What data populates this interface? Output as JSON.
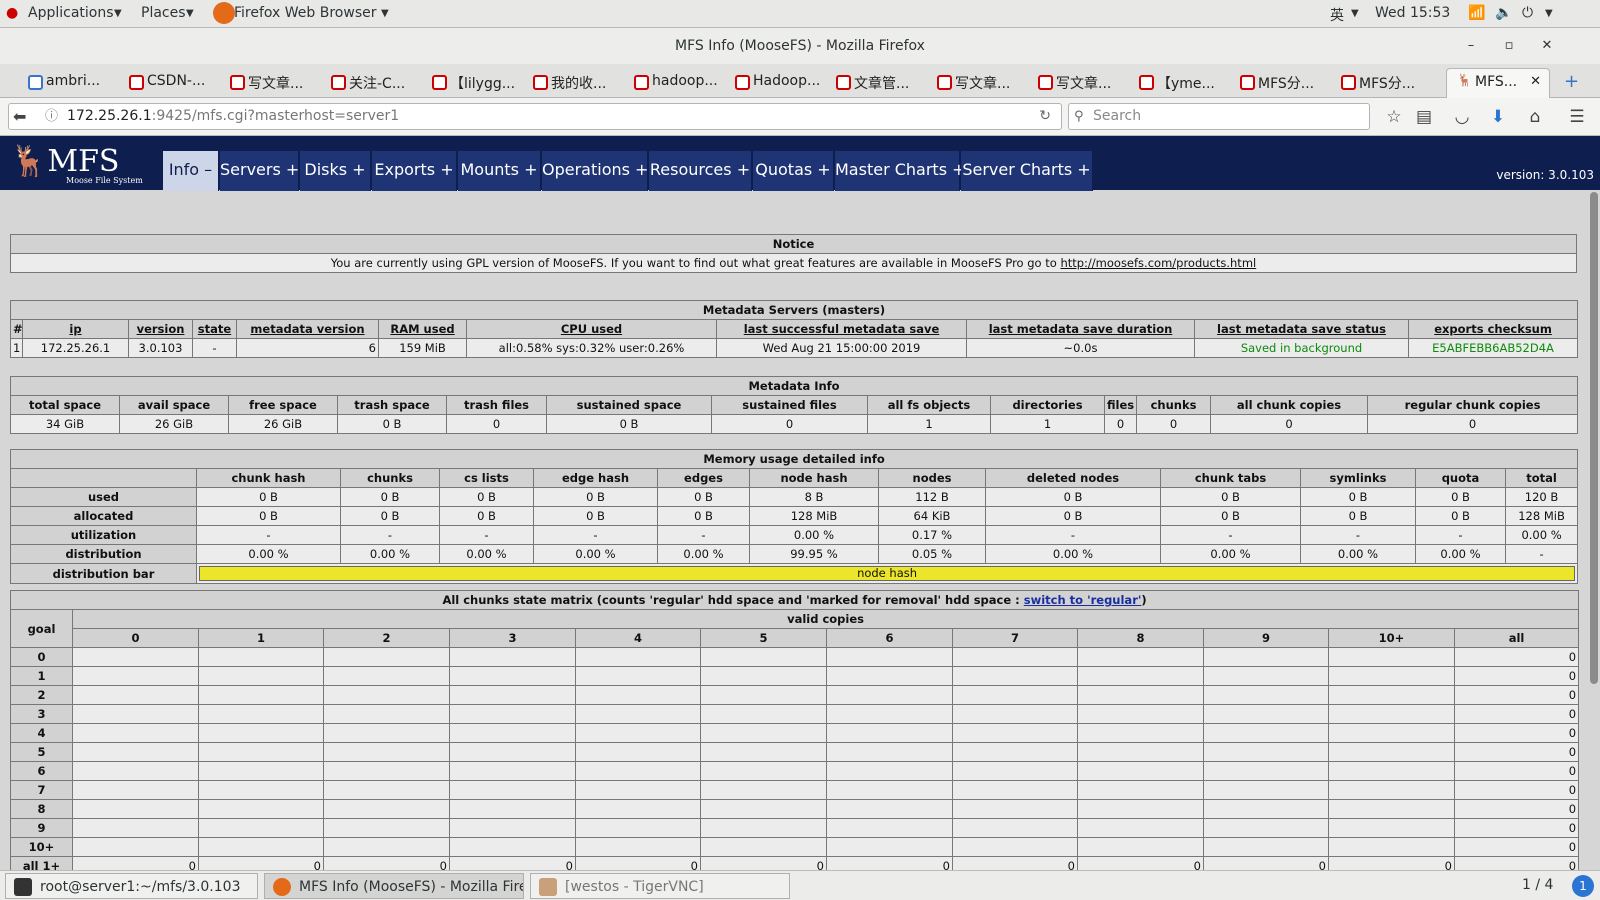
{
  "system_bar": {
    "applications": "Applications",
    "places": "Places",
    "active_app": "Firefox Web Browser",
    "ime": "英",
    "clock": "Wed 15:53"
  },
  "window": {
    "title": "MFS Info (MooseFS) - Mozilla Firefox",
    "minimize": "–",
    "maximize": "▫",
    "close": "✕"
  },
  "tabs": [
    {
      "label": "ambri..."
    },
    {
      "label": "CSDN-..."
    },
    {
      "label": "写文章..."
    },
    {
      "label": "关注-C..."
    },
    {
      "label": "【lilygg..."
    },
    {
      "label": "我的收..."
    },
    {
      "label": "hadoop..."
    },
    {
      "label": "Hadoop..."
    },
    {
      "label": "文章管..."
    },
    {
      "label": "写文章..."
    },
    {
      "label": "写文章..."
    },
    {
      "label": "【yme..."
    },
    {
      "label": "MFS分..."
    },
    {
      "label": "MFS分..."
    },
    {
      "label": "MFS..."
    }
  ],
  "navbar": {
    "url_host": "172.25.26.1",
    "url_rest": ":9425/mfs.cgi?masterhost=server1",
    "search_placeholder": "Search"
  },
  "mfs": {
    "logo": "MFS",
    "logo_sub": "Moose File System",
    "version": "version: 3.0.103",
    "menu": [
      "Info –",
      "Servers +",
      "Disks +",
      "Exports +",
      "Mounts +",
      "Operations +",
      "Resources +",
      "Quotas +",
      "Master Charts +",
      "Server Charts +"
    ]
  },
  "notice": {
    "title": "Notice",
    "text": "You are currently using GPL version of MooseFS. If you want to find out what great features are available in MooseFS Pro go to ",
    "link": "http://moosefs.com/products.html"
  },
  "metadata_servers": {
    "title": "Metadata Servers (masters)",
    "headers": [
      "#",
      "ip",
      "version",
      "state",
      "metadata version",
      "RAM used",
      "CPU used",
      "last successful metadata save",
      "last metadata save duration",
      "last metadata save status",
      "exports checksum"
    ],
    "row": [
      "1",
      "172.25.26.1",
      "3.0.103",
      "-",
      "6",
      "159 MiB",
      "all:0.58% sys:0.32% user:0.26%",
      "Wed Aug 21 15:00:00 2019",
      "~0.0s",
      "Saved in background",
      "E5ABFEBB6AB52D4A"
    ]
  },
  "metadata_info": {
    "title": "Metadata Info",
    "headers": [
      "total space",
      "avail space",
      "free space",
      "trash space",
      "trash files",
      "sustained space",
      "sustained files",
      "all fs objects",
      "directories",
      "files",
      "chunks",
      "all chunk copies",
      "regular chunk copies"
    ],
    "row": [
      "34 GiB",
      "26 GiB",
      "26 GiB",
      "0 B",
      "0",
      "0 B",
      "0",
      "1",
      "1",
      "0",
      "0",
      "0",
      "0"
    ]
  },
  "memory": {
    "title": "Memory usage detailed info",
    "headers": [
      "chunk hash",
      "chunks",
      "cs lists",
      "edge hash",
      "edges",
      "node hash",
      "nodes",
      "deleted nodes",
      "chunk tabs",
      "symlinks",
      "quota",
      "total"
    ],
    "rows": [
      {
        "label": "used",
        "values": [
          "0 B",
          "0 B",
          "0 B",
          "0 B",
          "0 B",
          "8 B",
          "112 B",
          "0 B",
          "0 B",
          "0 B",
          "0 B",
          "120 B"
        ]
      },
      {
        "label": "allocated",
        "values": [
          "0 B",
          "0 B",
          "0 B",
          "0 B",
          "0 B",
          "128 MiB",
          "64 KiB",
          "0 B",
          "0 B",
          "0 B",
          "0 B",
          "128 MiB"
        ]
      },
      {
        "label": "utilization",
        "values": [
          "-",
          "-",
          "-",
          "-",
          "-",
          "0.00 %",
          "0.17 %",
          "-",
          "-",
          "-",
          "-",
          "0.00 %"
        ]
      },
      {
        "label": "distribution",
        "values": [
          "0.00 %",
          "0.00 %",
          "0.00 %",
          "0.00 %",
          "0.00 %",
          "99.95 %",
          "0.05 %",
          "0.00 %",
          "0.00 %",
          "0.00 %",
          "0.00 %",
          "-"
        ]
      }
    ],
    "bar_label": "distribution bar",
    "bar_text": "node hash",
    "bar_color": "#ece62a"
  },
  "matrix": {
    "title_pre": "All chunks state matrix (counts 'regular' hdd space and 'marked for removal' hdd space : ",
    "title_link": "switch to 'regular'",
    "title_post": ")",
    "goal_label": "goal",
    "valid_copies": "valid copies",
    "columns": [
      "0",
      "1",
      "2",
      "3",
      "4",
      "5",
      "6",
      "7",
      "8",
      "9",
      "10+",
      "all"
    ],
    "rows": [
      "0",
      "1",
      "2",
      "3",
      "4",
      "5",
      "6",
      "7",
      "8",
      "9",
      "10+"
    ],
    "row_all": "0",
    "total_label": "all 1+",
    "total_row": [
      "0",
      "0",
      "0",
      "0",
      "0",
      "0",
      "0",
      "0",
      "0",
      "0",
      "0",
      "0"
    ]
  },
  "taskbar": {
    "items": [
      "root@server1:~/mfs/3.0.103",
      "MFS Info (MooseFS) - Mozilla Fire...",
      "[westos - TigerVNC]"
    ],
    "pager": "1 / 4"
  }
}
